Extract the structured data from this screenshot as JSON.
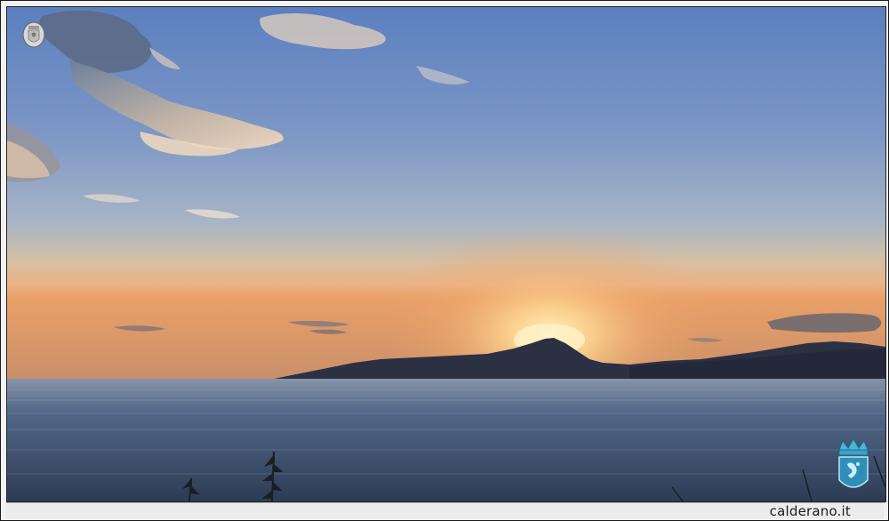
{
  "photo": {
    "subject": "sunset-over-sea-with-mountain-silhouette",
    "colors": {
      "sky_top": "#5f82c1",
      "sky_mid": "#8fa6c6",
      "horizon_glow": "#f2b873",
      "horizon_orange": "#e9975a",
      "sun": "#ffe9a8",
      "mountain": "#2a3040",
      "sea_far": "#5d7294",
      "sea_near": "#2f3f57",
      "cloud": "#f4dcc0"
    }
  },
  "watermark": {
    "caption": "calderano.it",
    "top_left_logo": "coat-of-arms-emblem",
    "bottom_right_logo": "crowned-shield-crest"
  }
}
